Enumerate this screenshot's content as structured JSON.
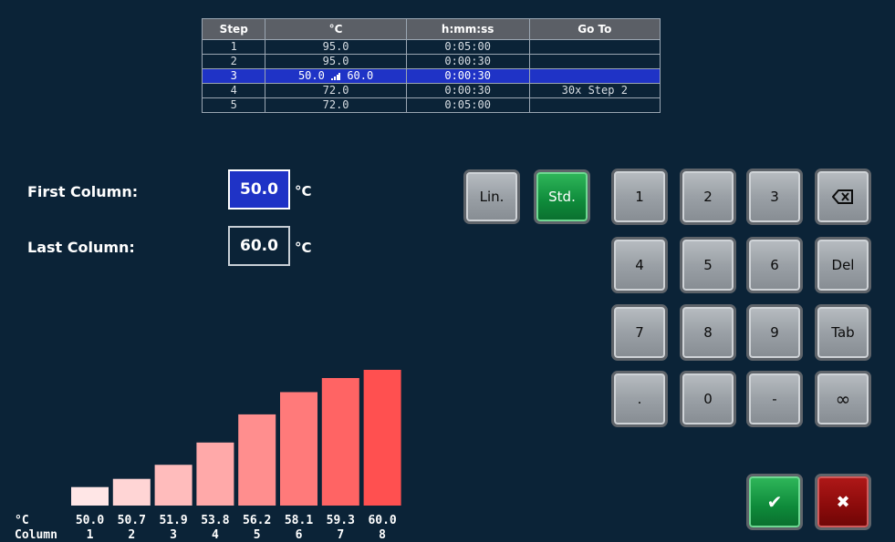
{
  "table": {
    "headers": [
      "Step",
      "°C",
      "h:mm:ss",
      "Go To"
    ],
    "rows": [
      {
        "step": "1",
        "temp": "95.0",
        "time": "0:05:00",
        "goto": ""
      },
      {
        "step": "2",
        "temp": "95.0",
        "time": "0:00:30",
        "goto": ""
      },
      {
        "step": "3",
        "temp_from": "50.0",
        "temp_to": "60.0",
        "time": "0:00:30",
        "goto": "",
        "selected": true
      },
      {
        "step": "4",
        "temp": "72.0",
        "time": "0:00:30",
        "goto": "30x Step 2"
      },
      {
        "step": "5",
        "temp": "72.0",
        "time": "0:05:00",
        "goto": ""
      }
    ]
  },
  "form": {
    "first_label": "First Column:",
    "first_value": "50.0",
    "last_label": "Last Column:",
    "last_value": "60.0",
    "unit": "°C"
  },
  "mode_buttons": {
    "lin": "Lin.",
    "std": "Std."
  },
  "keypad": {
    "k1": "1",
    "k2": "2",
    "k3": "3",
    "k4": "4",
    "k5": "5",
    "k6": "6",
    "k7": "7",
    "k8": "8",
    "k9": "9",
    "kdot": ".",
    "k0": "0",
    "kminus": "-",
    "del": "Del",
    "tab": "Tab",
    "inf": "∞",
    "ok": "✔",
    "cancel": "✖"
  },
  "colors": {
    "background": "#0b2337",
    "selected_row": "#1f33c6",
    "active_field": "#1f33c6",
    "std_button": "#0e8a3a",
    "ok_button": "#0e8a3a",
    "cancel_button": "#8a0b0b"
  },
  "chart_data": {
    "type": "bar",
    "ylabel": "°C",
    "xlabel": "Column",
    "categories": [
      "1",
      "2",
      "3",
      "4",
      "5",
      "6",
      "7",
      "8"
    ],
    "values": [
      50.0,
      50.7,
      51.9,
      53.8,
      56.2,
      58.1,
      59.3,
      60.0
    ],
    "value_labels": [
      "50.0",
      "50.7",
      "51.9",
      "53.8",
      "56.2",
      "58.1",
      "59.3",
      "60.0"
    ],
    "bar_colors": [
      "#ffe6e6",
      "#ffd5d5",
      "#ffbcbc",
      "#ffa9a9",
      "#ff8e8e",
      "#ff7a7a",
      "#ff6464",
      "#ff5050"
    ]
  }
}
